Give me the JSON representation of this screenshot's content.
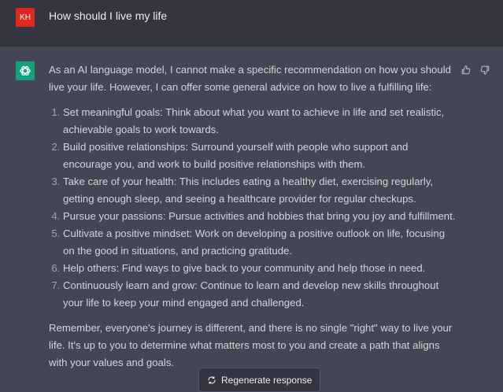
{
  "user": {
    "initials": "KH",
    "message": "How should I live my life"
  },
  "assistant": {
    "intro": "As an AI language model, I cannot make a specific recommendation on how you should live your life. However, I can offer some general advice on how to live a fulfilling life:",
    "items": [
      "Set meaningful goals: Think about what you want to achieve in life and set realistic, achievable goals to work towards.",
      "Build positive relationships: Surround yourself with people who support and encourage you, and work to build positive relationships with them.",
      "Take care of your health: This includes eating a healthy diet, exercising regularly, getting enough sleep, and seeing a healthcare provider for regular checkups.",
      "Pursue your passions: Pursue activities and hobbies that bring you joy and fulfillment.",
      "Cultivate a positive mindset: Work on developing a positive outlook on life, focusing on the good in situations, and practicing gratitude.",
      "Help others: Find ways to give back to your community and help those in need.",
      "Continuously learn and grow: Continue to learn and develop new skills throughout your life to keep your mind engaged and challenged."
    ],
    "outro": "Remember, everyone's journey is different, and there is no single \"right\" way to live your life. It's up to you to determine what matters most to you and create a path that aligns with your values and goals."
  },
  "actions": {
    "regenerate_label": "Regenerate response"
  },
  "colors": {
    "user_bg": "#343541",
    "assistant_bg": "#444654",
    "user_avatar": "#e0281f",
    "bot_avatar": "#10a37f"
  }
}
